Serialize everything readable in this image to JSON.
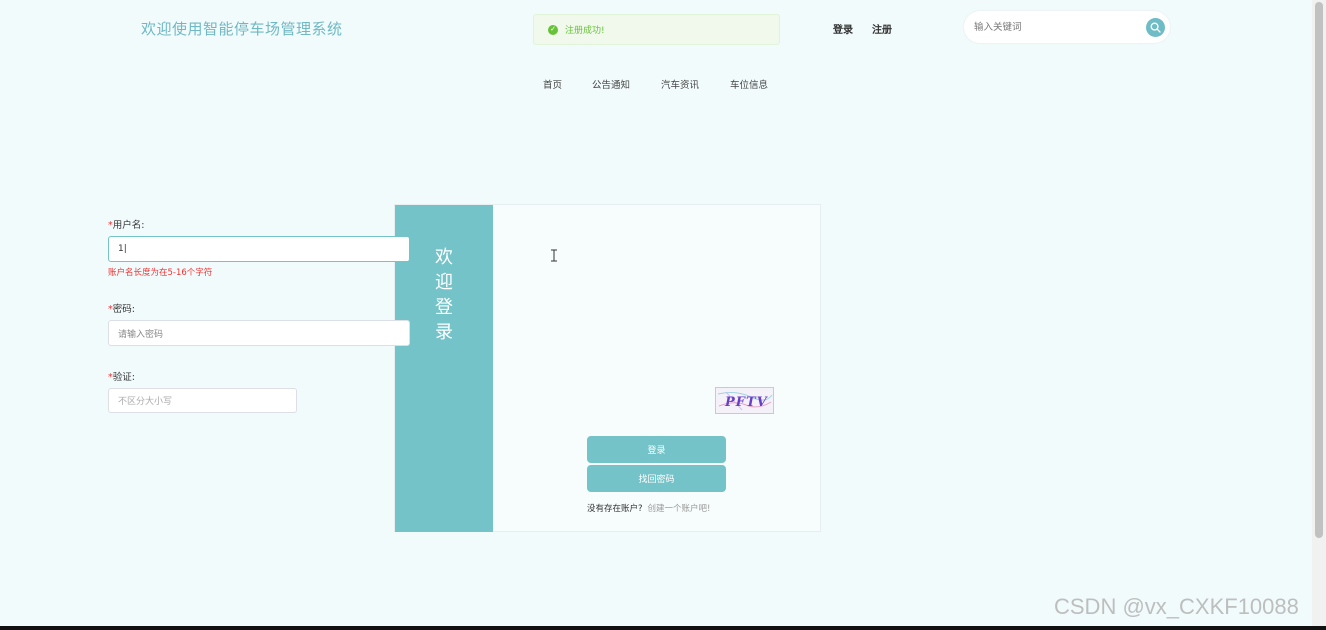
{
  "header": {
    "site_title": "欢迎使用智能停车场管理系统",
    "toast": {
      "text": "注册成功!",
      "type": "success"
    },
    "links": {
      "login": "登录",
      "register": "注册"
    },
    "search": {
      "placeholder": "输入关键词",
      "icon": "search-icon"
    }
  },
  "nav": {
    "items": [
      {
        "label": "首页"
      },
      {
        "label": "公告通知"
      },
      {
        "label": "汽车资讯"
      },
      {
        "label": "车位信息"
      }
    ]
  },
  "login": {
    "welcome_chars": [
      "欢",
      "迎",
      "登",
      "录"
    ],
    "username": {
      "required_mark": "*",
      "label": "用户名:",
      "value": "1|",
      "error": "账户名长度为在5-16个字符"
    },
    "password": {
      "required_mark": "*",
      "label": "密码:",
      "placeholder": "请输入密码"
    },
    "captcha": {
      "required_mark": "*",
      "label": "验证:",
      "placeholder": "不区分大小写",
      "image_text": "PFTV"
    },
    "login_button": "登录",
    "forgot_button": "找回密码",
    "no_account_text": "没有存在账户?",
    "create_account_link": "创建一个账户吧!"
  },
  "watermark": "CSDN @vx_CXKF10088",
  "colors": {
    "accent": "#74c3c8",
    "title": "#6fb8c4",
    "success": "#67c23a",
    "error": "#e33333",
    "background": "#f2fbfc"
  }
}
